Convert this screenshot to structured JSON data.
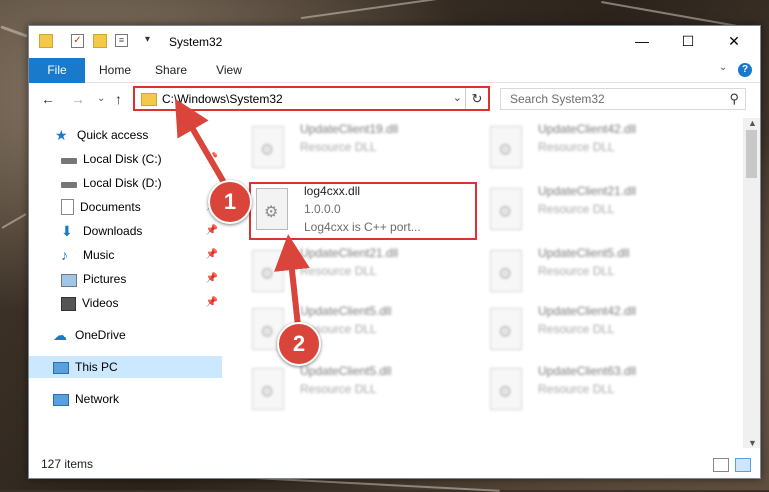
{
  "window": {
    "title": "System32"
  },
  "ribbon": {
    "file": "File",
    "home": "Home",
    "share": "Share",
    "view": "View",
    "help": "?"
  },
  "address": {
    "path": "C:\\Windows\\System32",
    "search_placeholder": "Search System32"
  },
  "sidebar": {
    "items": [
      {
        "label": "Quick access"
      },
      {
        "label": "Local Disk (C:)"
      },
      {
        "label": "Local Disk (D:)"
      },
      {
        "label": "Documents"
      },
      {
        "label": "Downloads"
      },
      {
        "label": "Music"
      },
      {
        "label": "Pictures"
      },
      {
        "label": "Videos"
      },
      {
        "label": "OneDrive"
      },
      {
        "label": "This PC"
      },
      {
        "label": "Network"
      }
    ]
  },
  "files": {
    "highlight": {
      "name": "log4cxx.dll",
      "version": "1.0.0.0",
      "desc": "Log4cxx is C++ port..."
    },
    "blurred": [
      {
        "name": "UpdateClient19.dll",
        "desc": "Resource DLL"
      },
      {
        "name": "UpdateClient42.dll",
        "desc": "Resource DLL"
      },
      {
        "name": "UpdateClient21.dll",
        "desc": "Resource DLL"
      },
      {
        "name": "UpdateClient21.dll",
        "desc": "Resource DLL"
      },
      {
        "name": "UpdateClient5.dll",
        "desc": "Resource DLL"
      },
      {
        "name": "UpdateClient5.dll",
        "desc": "Resource DLL"
      },
      {
        "name": "UpdateClient42.dll",
        "desc": "Resource DLL"
      },
      {
        "name": "UpdateClient5.dll",
        "desc": "Resource DLL"
      },
      {
        "name": "UpdateClient63.dll",
        "desc": "Resource DLL"
      }
    ]
  },
  "status": {
    "count": "127 items"
  },
  "annotations": {
    "badge1": "1",
    "badge2": "2"
  },
  "colors": {
    "accent": "#1979ca",
    "highlight": "#e03131",
    "badge": "#d9453b"
  }
}
